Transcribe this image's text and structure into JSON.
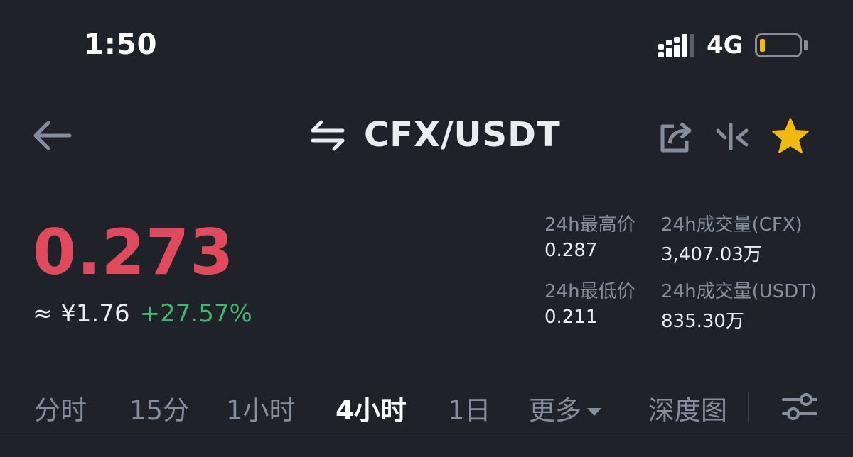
{
  "status_bar": {
    "time": "1:50",
    "network": "4G"
  },
  "header": {
    "pair": "CFX/USDT"
  },
  "price": {
    "last": "0.273",
    "cny": "≈ ¥1.76",
    "change": "+27.57%"
  },
  "stats": {
    "high_label": "24h最高价",
    "high_value": "0.287",
    "vol_cfx_label": "24h成交量(CFX)",
    "vol_cfx_value": "3,407.03万",
    "low_label": "24h最低价",
    "low_value": "0.211",
    "vol_usdt_label": "24h成交量(USDT)",
    "vol_usdt_value": "835.30万"
  },
  "tabs": [
    {
      "label": "分时"
    },
    {
      "label": "15分"
    },
    {
      "label": "1小时"
    },
    {
      "label": "4小时"
    },
    {
      "label": "1日"
    },
    {
      "label": "更多"
    },
    {
      "label": "深度图"
    }
  ],
  "active_tab": "4小时",
  "colors": {
    "up": "#3fb771",
    "down": "#e04a5c",
    "accent": "#f0b90b",
    "bg": "#1f2229"
  },
  "icons": [
    "back-arrow-icon",
    "swap-icon",
    "share-icon",
    "compare-icon",
    "star-icon",
    "settings-sliders-icon"
  ]
}
